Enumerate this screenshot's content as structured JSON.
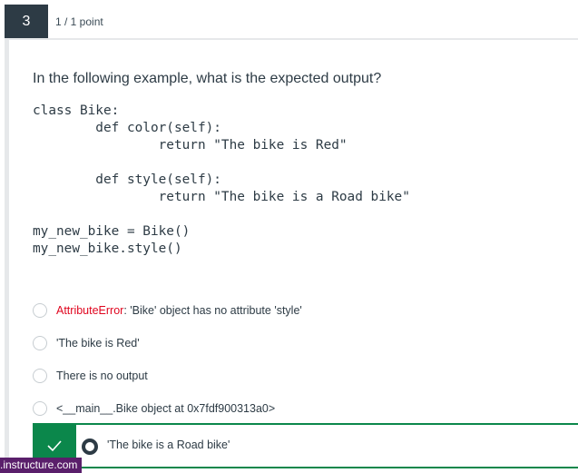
{
  "question": {
    "number": "3",
    "points": "1 / 1 point",
    "prompt": "In the following example, what is the expected output?",
    "code": "class Bike:\n        def color(self):\n                return \"The bike is Red\"\n\n        def style(self):\n                return \"The bike is a Road bike\"\n\nmy_new_bike = Bike()\nmy_new_bike.style()"
  },
  "answers": [
    {
      "error_prefix": "AttributeError",
      "text": ": 'Bike' object has no attribute 'style'"
    },
    {
      "text": "'The bike is Red'"
    },
    {
      "text": "There is no output"
    },
    {
      "text": "<__main__.Bike object at 0x7fdf900313a0>"
    }
  ],
  "correct_answer": {
    "text": "'The bike is a Road bike'",
    "selected": true,
    "status": "correct"
  },
  "watermark": ".instructure.com",
  "colors": {
    "question_number_bg": "#2d3b45",
    "correct_green": "#0b874b",
    "error_red": "#e0061f",
    "watermark_bg": "#5a1f6b"
  }
}
